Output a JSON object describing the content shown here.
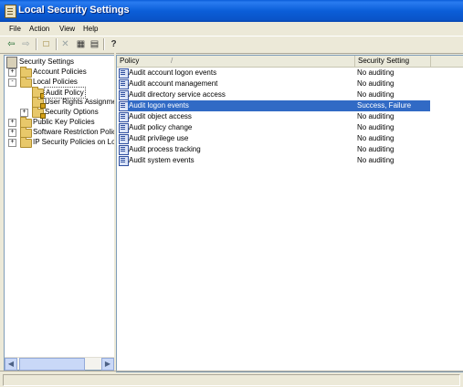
{
  "window": {
    "title": "Local Security Settings"
  },
  "menu": [
    "File",
    "Action",
    "View",
    "Help"
  ],
  "toolbar": {
    "buttons": [
      "back-arrow-icon",
      "forward-arrow-icon",
      "up-folder-icon",
      "delete-icon",
      "properties-icon",
      "export-list-icon",
      "help-icon"
    ]
  },
  "tree": {
    "root": "Security Settings",
    "items": [
      {
        "label": "Account Policies",
        "expander": "+"
      },
      {
        "label": "Local Policies",
        "expander": "-"
      },
      {
        "label": "Audit Policy",
        "expander": ""
      },
      {
        "label": "User Rights Assignmen",
        "expander": ""
      },
      {
        "label": "Security Options",
        "expander": "+"
      },
      {
        "label": "Public Key Policies",
        "expander": "+"
      },
      {
        "label": "Software Restriction Policie",
        "expander": "+"
      },
      {
        "label": "IP Security Policies on Loca",
        "expander": "+"
      }
    ],
    "selected": "Audit Policy"
  },
  "list": {
    "columns": {
      "policy": "Policy",
      "setting": "Security Setting",
      "sort_indicator": "/"
    },
    "rows": [
      {
        "policy": "Audit account logon events",
        "setting": "No auditing"
      },
      {
        "policy": "Audit account management",
        "setting": "No auditing"
      },
      {
        "policy": "Audit directory service access",
        "setting": "No auditing"
      },
      {
        "policy": "Audit logon events",
        "setting": "Success, Failure"
      },
      {
        "policy": "Audit object access",
        "setting": "No auditing"
      },
      {
        "policy": "Audit policy change",
        "setting": "No auditing"
      },
      {
        "policy": "Audit privilege use",
        "setting": "No auditing"
      },
      {
        "policy": "Audit process tracking",
        "setting": "No auditing"
      },
      {
        "policy": "Audit system events",
        "setting": "No auditing"
      }
    ],
    "selected_row": "Audit logon events"
  },
  "colors": {
    "title_bar": "#0a5cd8",
    "selection": "#316ac5",
    "window_bg": "#ece9d8"
  }
}
